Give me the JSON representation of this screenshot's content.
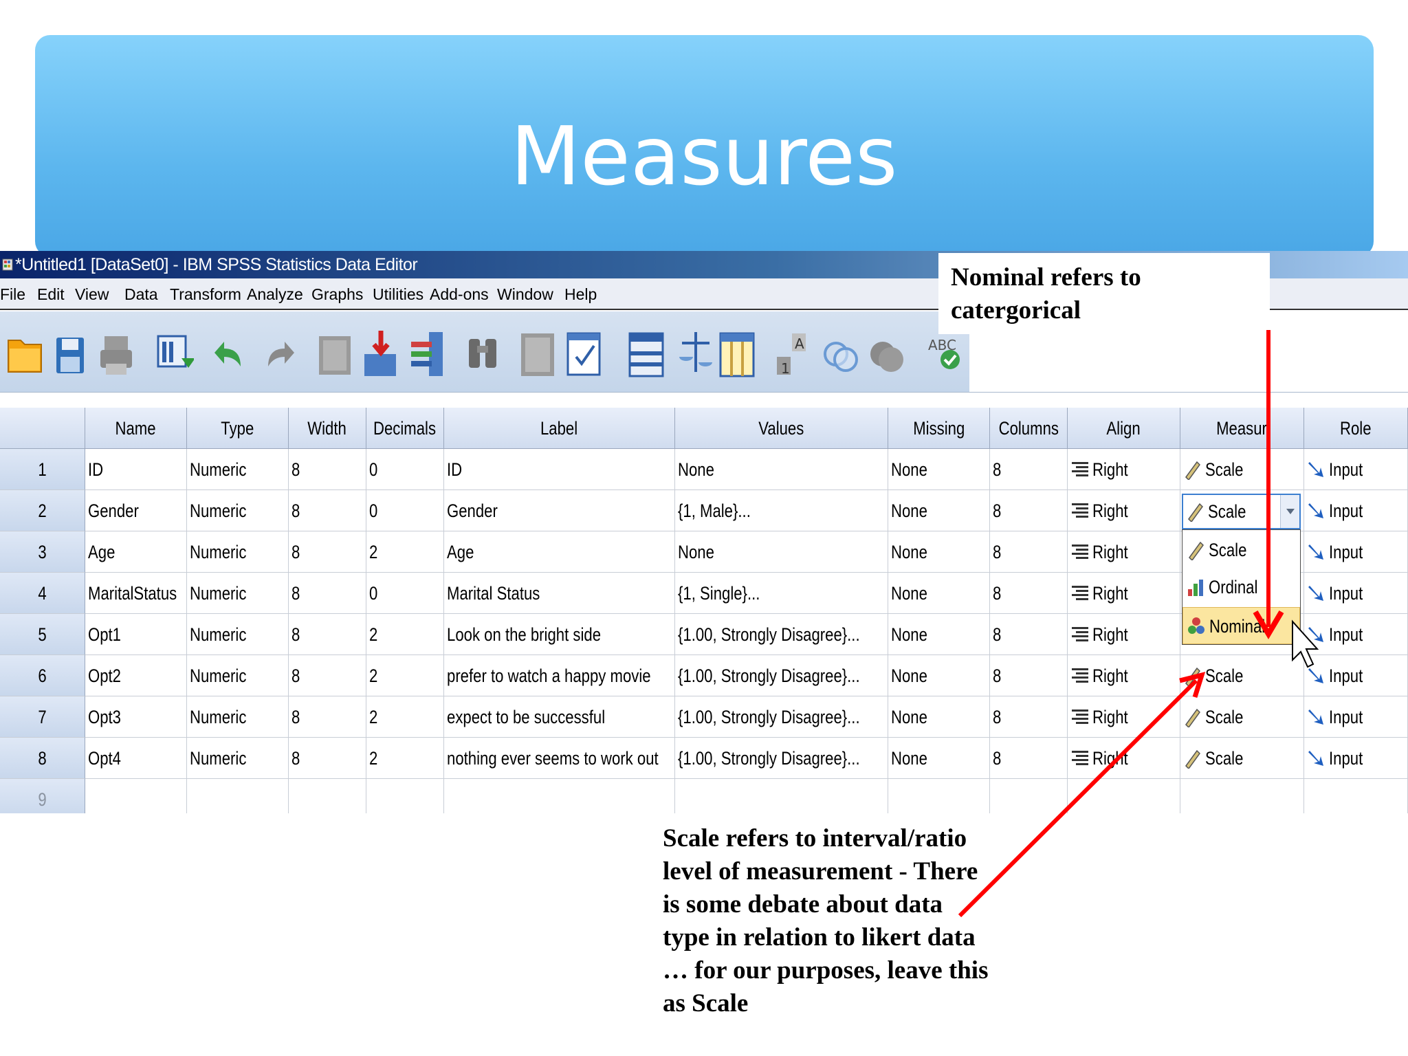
{
  "slide": {
    "title": "Measures"
  },
  "window": {
    "title": "*Untitled1 [DataSet0] - IBM SPSS Statistics Data Editor"
  },
  "menu": [
    "File",
    "Edit",
    "View",
    "Data",
    "Transform",
    "Analyze",
    "Graphs",
    "Utilities",
    "Add-ons",
    "Window",
    "Help"
  ],
  "toolbar_icons": [
    "open-folder-icon",
    "save-icon",
    "print-icon",
    "recall-dialog-icon",
    "undo-icon",
    "redo-icon",
    "goto-case-icon",
    "goto-variable-icon",
    "variables-icon",
    "find-icon",
    "insert-cases-icon",
    "insert-variable-icon",
    "split-file-icon",
    "weight-cases-icon",
    "select-cases-icon",
    "value-labels-icon",
    "use-sets-icon",
    "show-all-variables-icon",
    "spell-check-icon"
  ],
  "grid": {
    "columns": [
      "Name",
      "Type",
      "Width",
      "Decimals",
      "Label",
      "Values",
      "Missing",
      "Columns",
      "Align",
      "Measur",
      "Role"
    ],
    "rows": [
      {
        "num": "1",
        "name": "ID",
        "type": "Numeric",
        "width": "8",
        "decimals": "0",
        "label": "ID",
        "values": "None",
        "missing": "None",
        "columns": "8",
        "align": "Right",
        "measure": "Scale",
        "role": "Input"
      },
      {
        "num": "2",
        "name": "Gender",
        "type": "Numeric",
        "width": "8",
        "decimals": "0",
        "label": "Gender",
        "values": "{1, Male}...",
        "missing": "None",
        "columns": "8",
        "align": "Right",
        "measure": "Scale",
        "role": "Input"
      },
      {
        "num": "3",
        "name": "Age",
        "type": "Numeric",
        "width": "8",
        "decimals": "2",
        "label": "Age",
        "values": "None",
        "missing": "None",
        "columns": "8",
        "align": "Right",
        "measure": "",
        "role": "Input"
      },
      {
        "num": "4",
        "name": "MaritalStatus",
        "type": "Numeric",
        "width": "8",
        "decimals": "0",
        "label": "Marital Status",
        "values": "{1, Single}...",
        "missing": "None",
        "columns": "8",
        "align": "Right",
        "measure": "",
        "role": "Input"
      },
      {
        "num": "5",
        "name": "Opt1",
        "type": "Numeric",
        "width": "8",
        "decimals": "2",
        "label": "Look on the bright side",
        "values": "{1.00, Strongly Disagree}...",
        "missing": "None",
        "columns": "8",
        "align": "Right",
        "measure": "",
        "role": "Input"
      },
      {
        "num": "6",
        "name": "Opt2",
        "type": "Numeric",
        "width": "8",
        "decimals": "2",
        "label": "prefer to watch a happy movie",
        "values": "{1.00, Strongly Disagree}...",
        "missing": "None",
        "columns": "8",
        "align": "Right",
        "measure": "Scale",
        "role": "Input"
      },
      {
        "num": "7",
        "name": "Opt3",
        "type": "Numeric",
        "width": "8",
        "decimals": "2",
        "label": "expect to be successful",
        "values": "{1.00, Strongly Disagree}...",
        "missing": "None",
        "columns": "8",
        "align": "Right",
        "measure": "Scale",
        "role": "Input"
      },
      {
        "num": "8",
        "name": "Opt4",
        "type": "Numeric",
        "width": "8",
        "decimals": "2",
        "label": "nothing ever seems to work out",
        "values": "{1.00, Strongly Disagree}...",
        "missing": "None",
        "columns": "8",
        "align": "Right",
        "measure": "Scale",
        "role": "Input"
      },
      {
        "num": "9",
        "name": "",
        "type": "",
        "width": "",
        "decimals": "",
        "label": "",
        "values": "",
        "missing": "",
        "columns": "",
        "align": "",
        "measure": "",
        "role": ""
      }
    ]
  },
  "dropdown": {
    "selected": "Scale",
    "options": [
      "Scale",
      "Ordinal",
      "Nominal"
    ],
    "highlighted": "Nominal"
  },
  "annotations": {
    "top": "Nominal refers to catergorical",
    "bottom": "Scale refers to interval/ratio level of measurement - There is some debate about data type in relation to likert data … for our purposes, leave this as Scale"
  },
  "colors": {
    "banner": "#5cb6ee",
    "arrow": "#ff0000",
    "titlebar": "#0a246a",
    "selection": "#fbe6a0"
  }
}
